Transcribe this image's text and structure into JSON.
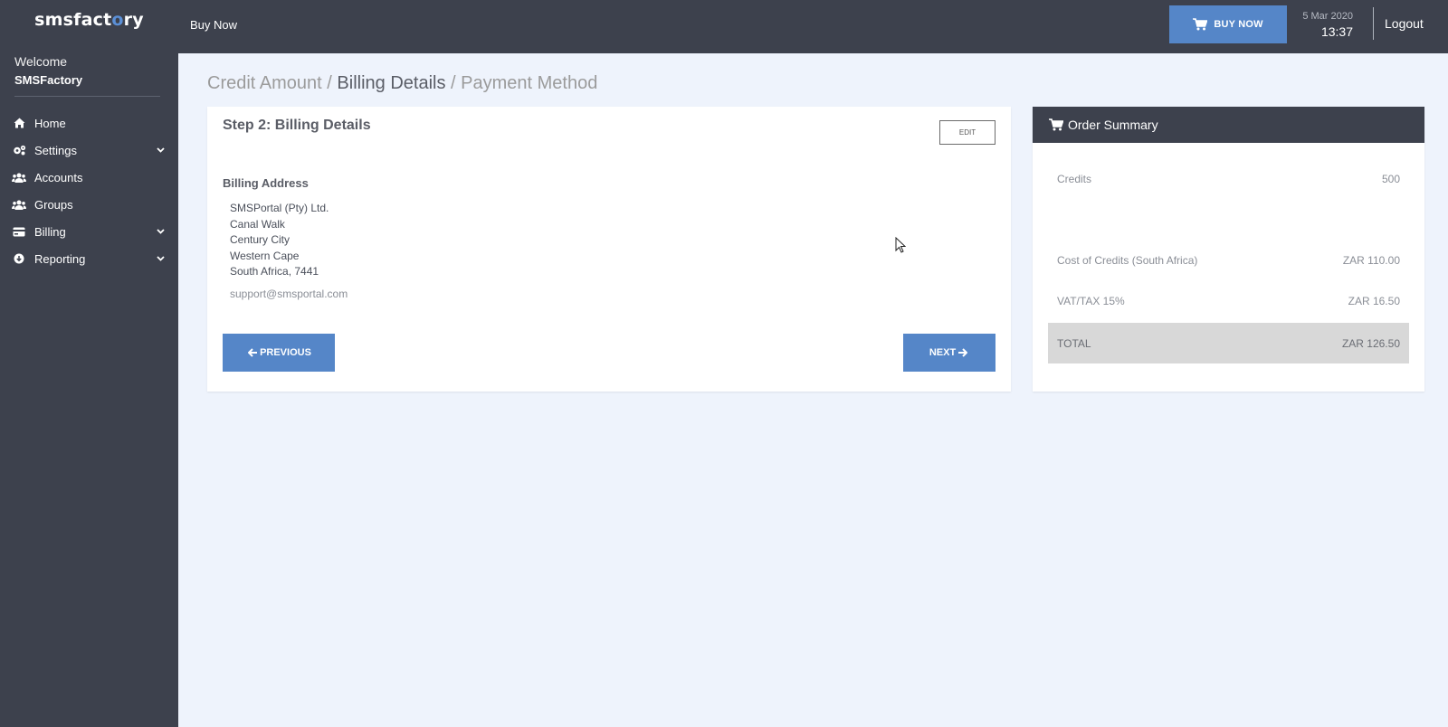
{
  "brand": {
    "logo_prefix": "smsfact",
    "logo_o": "o",
    "logo_suffix": "ry"
  },
  "sidebar": {
    "welcome": "Welcome",
    "username": "SMSFactory",
    "items": [
      {
        "label": "Home",
        "icon": "home-icon",
        "has_submenu": false
      },
      {
        "label": "Settings",
        "icon": "cogs-icon",
        "has_submenu": true
      },
      {
        "label": "Accounts",
        "icon": "users-icon",
        "has_submenu": false
      },
      {
        "label": "Groups",
        "icon": "users-icon",
        "has_submenu": false
      },
      {
        "label": "Billing",
        "icon": "credit-card-icon",
        "has_submenu": true
      },
      {
        "label": "Reporting",
        "icon": "chart-icon",
        "has_submenu": true
      }
    ]
  },
  "topbar": {
    "title": "Buy Now",
    "buy_now_label": "BUY NOW",
    "date": "5 Mar 2020",
    "time": "13:37",
    "logout": "Logout"
  },
  "breadcrumb": {
    "step1": "Credit Amount",
    "sep1": " / ",
    "step2": "Billing Details",
    "sep2": " / ",
    "step3": "Payment Method"
  },
  "billing": {
    "step_title": "Step 2: Billing Details",
    "edit_label": "EDIT",
    "address_heading": "Billing Address",
    "address_lines": [
      "SMSPortal (Pty) Ltd.",
      "Canal Walk",
      "Century City",
      "Western Cape",
      "South Africa, 7441"
    ],
    "email": "support@smsportal.com",
    "previous_label": "PREVIOUS",
    "next_label": "NEXT"
  },
  "summary": {
    "title": "Order Summary",
    "rows": [
      {
        "label": "Credits",
        "value": "500"
      },
      {
        "label": "Cost of Credits (South Africa)",
        "value": "ZAR 110.00"
      },
      {
        "label": "VAT/TAX 15%",
        "value": "ZAR 16.50"
      }
    ],
    "total_label": "TOTAL",
    "total_value": "ZAR 126.50"
  },
  "colors": {
    "sidebar_bg": "#3d414d",
    "page_bg": "#eef3fc",
    "accent": "#5586c8",
    "total_bg": "#d8d8d8"
  }
}
